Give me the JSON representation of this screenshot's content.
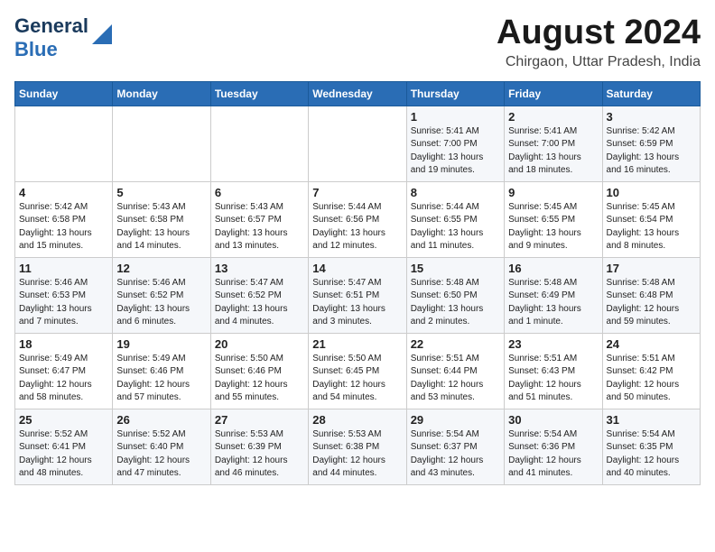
{
  "logo": {
    "line1": "General",
    "line2": "Blue"
  },
  "title": "August 2024",
  "subtitle": "Chirgaon, Uttar Pradesh, India",
  "days_of_week": [
    "Sunday",
    "Monday",
    "Tuesday",
    "Wednesday",
    "Thursday",
    "Friday",
    "Saturday"
  ],
  "weeks": [
    [
      {
        "day": "",
        "info": ""
      },
      {
        "day": "",
        "info": ""
      },
      {
        "day": "",
        "info": ""
      },
      {
        "day": "",
        "info": ""
      },
      {
        "day": "1",
        "info": "Sunrise: 5:41 AM\nSunset: 7:00 PM\nDaylight: 13 hours\nand 19 minutes."
      },
      {
        "day": "2",
        "info": "Sunrise: 5:41 AM\nSunset: 7:00 PM\nDaylight: 13 hours\nand 18 minutes."
      },
      {
        "day": "3",
        "info": "Sunrise: 5:42 AM\nSunset: 6:59 PM\nDaylight: 13 hours\nand 16 minutes."
      }
    ],
    [
      {
        "day": "4",
        "info": "Sunrise: 5:42 AM\nSunset: 6:58 PM\nDaylight: 13 hours\nand 15 minutes."
      },
      {
        "day": "5",
        "info": "Sunrise: 5:43 AM\nSunset: 6:58 PM\nDaylight: 13 hours\nand 14 minutes."
      },
      {
        "day": "6",
        "info": "Sunrise: 5:43 AM\nSunset: 6:57 PM\nDaylight: 13 hours\nand 13 minutes."
      },
      {
        "day": "7",
        "info": "Sunrise: 5:44 AM\nSunset: 6:56 PM\nDaylight: 13 hours\nand 12 minutes."
      },
      {
        "day": "8",
        "info": "Sunrise: 5:44 AM\nSunset: 6:55 PM\nDaylight: 13 hours\nand 11 minutes."
      },
      {
        "day": "9",
        "info": "Sunrise: 5:45 AM\nSunset: 6:55 PM\nDaylight: 13 hours\nand 9 minutes."
      },
      {
        "day": "10",
        "info": "Sunrise: 5:45 AM\nSunset: 6:54 PM\nDaylight: 13 hours\nand 8 minutes."
      }
    ],
    [
      {
        "day": "11",
        "info": "Sunrise: 5:46 AM\nSunset: 6:53 PM\nDaylight: 13 hours\nand 7 minutes."
      },
      {
        "day": "12",
        "info": "Sunrise: 5:46 AM\nSunset: 6:52 PM\nDaylight: 13 hours\nand 6 minutes."
      },
      {
        "day": "13",
        "info": "Sunrise: 5:47 AM\nSunset: 6:52 PM\nDaylight: 13 hours\nand 4 minutes."
      },
      {
        "day": "14",
        "info": "Sunrise: 5:47 AM\nSunset: 6:51 PM\nDaylight: 13 hours\nand 3 minutes."
      },
      {
        "day": "15",
        "info": "Sunrise: 5:48 AM\nSunset: 6:50 PM\nDaylight: 13 hours\nand 2 minutes."
      },
      {
        "day": "16",
        "info": "Sunrise: 5:48 AM\nSunset: 6:49 PM\nDaylight: 13 hours\nand 1 minute."
      },
      {
        "day": "17",
        "info": "Sunrise: 5:48 AM\nSunset: 6:48 PM\nDaylight: 12 hours\nand 59 minutes."
      }
    ],
    [
      {
        "day": "18",
        "info": "Sunrise: 5:49 AM\nSunset: 6:47 PM\nDaylight: 12 hours\nand 58 minutes."
      },
      {
        "day": "19",
        "info": "Sunrise: 5:49 AM\nSunset: 6:46 PM\nDaylight: 12 hours\nand 57 minutes."
      },
      {
        "day": "20",
        "info": "Sunrise: 5:50 AM\nSunset: 6:46 PM\nDaylight: 12 hours\nand 55 minutes."
      },
      {
        "day": "21",
        "info": "Sunrise: 5:50 AM\nSunset: 6:45 PM\nDaylight: 12 hours\nand 54 minutes."
      },
      {
        "day": "22",
        "info": "Sunrise: 5:51 AM\nSunset: 6:44 PM\nDaylight: 12 hours\nand 53 minutes."
      },
      {
        "day": "23",
        "info": "Sunrise: 5:51 AM\nSunset: 6:43 PM\nDaylight: 12 hours\nand 51 minutes."
      },
      {
        "day": "24",
        "info": "Sunrise: 5:51 AM\nSunset: 6:42 PM\nDaylight: 12 hours\nand 50 minutes."
      }
    ],
    [
      {
        "day": "25",
        "info": "Sunrise: 5:52 AM\nSunset: 6:41 PM\nDaylight: 12 hours\nand 48 minutes."
      },
      {
        "day": "26",
        "info": "Sunrise: 5:52 AM\nSunset: 6:40 PM\nDaylight: 12 hours\nand 47 minutes."
      },
      {
        "day": "27",
        "info": "Sunrise: 5:53 AM\nSunset: 6:39 PM\nDaylight: 12 hours\nand 46 minutes."
      },
      {
        "day": "28",
        "info": "Sunrise: 5:53 AM\nSunset: 6:38 PM\nDaylight: 12 hours\nand 44 minutes."
      },
      {
        "day": "29",
        "info": "Sunrise: 5:54 AM\nSunset: 6:37 PM\nDaylight: 12 hours\nand 43 minutes."
      },
      {
        "day": "30",
        "info": "Sunrise: 5:54 AM\nSunset: 6:36 PM\nDaylight: 12 hours\nand 41 minutes."
      },
      {
        "day": "31",
        "info": "Sunrise: 5:54 AM\nSunset: 6:35 PM\nDaylight: 12 hours\nand 40 minutes."
      }
    ]
  ]
}
